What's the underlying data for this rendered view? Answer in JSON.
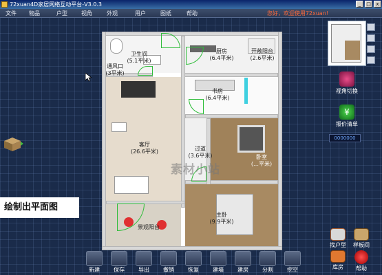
{
  "window": {
    "title": "72xuan4D家居网络互动平台-V3.0.3"
  },
  "menu": {
    "items": [
      "文件",
      "物品",
      "户型",
      "视角",
      "外观",
      "用户",
      "图纸",
      "帮助"
    ]
  },
  "welcome_text": "您好，欢迎使用72xuan!",
  "rooms": [
    {
      "name": "卫生间",
      "area": "(5.1平米)"
    },
    {
      "name": "通风口",
      "area": "(3平米)"
    },
    {
      "name": "厨房",
      "area": "(6.4平米)"
    },
    {
      "name": "开敞阳台",
      "area": "(2.6平米)"
    },
    {
      "name": "书房",
      "area": "(6.4平米)"
    },
    {
      "name": "客厅",
      "area": "(26.6平米)"
    },
    {
      "name": "过道",
      "area": "(3.6平米)"
    },
    {
      "name": "卧室",
      "area": "(…平米)"
    },
    {
      "name": "主卧",
      "area": "(9.9平米)"
    },
    {
      "name": "景观阳台",
      "area": ""
    }
  ],
  "watermark": "素材小站",
  "caption": "绘制出平面图",
  "side_buttons": {
    "view_switch": "视角切换",
    "quote_list": "报价清单"
  },
  "coord_readout": "0000000",
  "bottom_right": {
    "floorplan": "找户型",
    "template": "样板间",
    "library": "库房",
    "help": "帮助"
  },
  "toolbar": [
    "新建",
    "保存",
    "导出",
    "撤销",
    "恢复",
    "建墙",
    "建房",
    "分割",
    "挖空"
  ],
  "colors": {
    "background": "#1a2b4a",
    "door_arc": "#2fbd3a",
    "welcome": "#ff6a3a"
  }
}
